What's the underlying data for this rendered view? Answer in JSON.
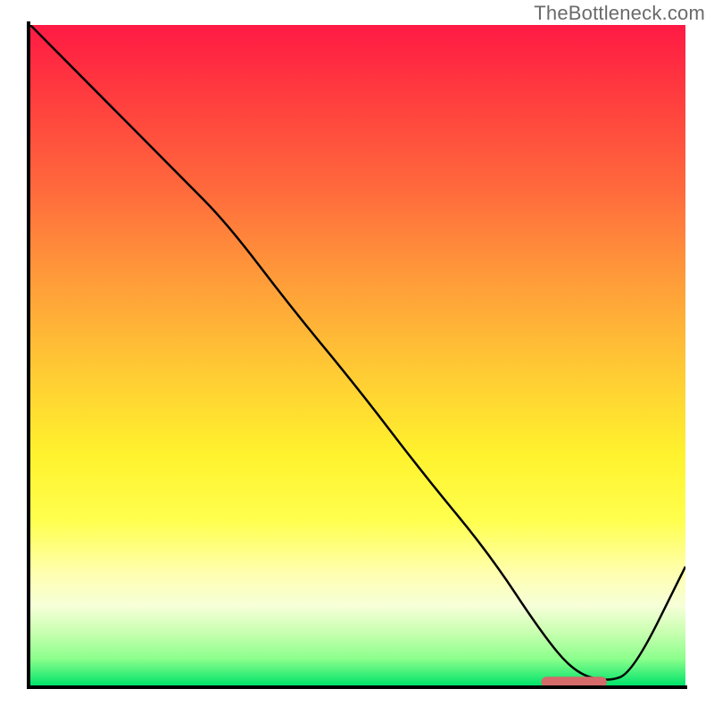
{
  "watermark": "TheBottleneck.com",
  "chart_data": {
    "type": "line",
    "title": "",
    "xlabel": "",
    "ylabel": "",
    "xlim": [
      0,
      100
    ],
    "ylim": [
      0,
      100
    ],
    "grid": false,
    "x": [
      0,
      6,
      23,
      30,
      40,
      50,
      60,
      70,
      78,
      83,
      88,
      92,
      100
    ],
    "values": [
      100,
      94,
      77,
      70,
      57,
      45,
      32,
      20,
      8,
      2,
      0.5,
      2,
      18
    ],
    "segment": {
      "x_start": 78,
      "x_end": 88,
      "y": 0.5,
      "color": "#d46a6a"
    },
    "background_gradient_stops": [
      {
        "pos": 0,
        "color": "#ff1a44"
      },
      {
        "pos": 25,
        "color": "#ff6a3c"
      },
      {
        "pos": 52,
        "color": "#ffc934"
      },
      {
        "pos": 75,
        "color": "#ffff4e"
      },
      {
        "pos": 88,
        "color": "#f6ffd8"
      },
      {
        "pos": 100,
        "color": "#00e36a"
      }
    ]
  }
}
